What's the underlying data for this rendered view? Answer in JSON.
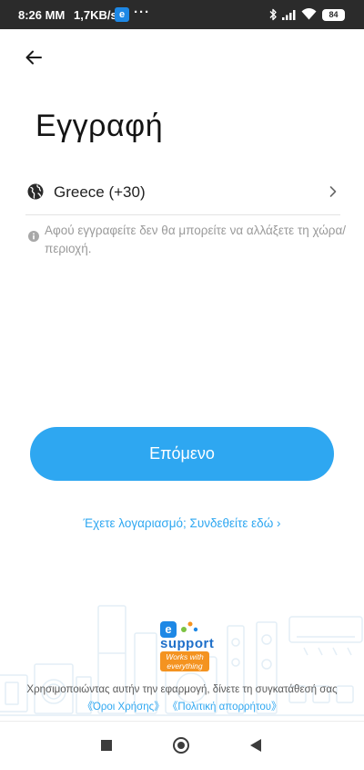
{
  "status_bar": {
    "time": "8:26 MM",
    "speed": "1,7KB/s",
    "app_badge": "e",
    "more": "···",
    "battery": "84"
  },
  "header": {
    "title": "Εγγραφή"
  },
  "country": {
    "label": "Greece (+30)"
  },
  "info": {
    "text": "Αφού εγγραφείτε δεν θα μπορείτε να αλλάξετε τη χώρα/περιοχή."
  },
  "actions": {
    "next_label": "Επόμενο",
    "login_link": "Έχετε λογαριασμό; Συνδεθείτε εδώ ›"
  },
  "logo": {
    "badge_letter": "e",
    "word": "support",
    "tagline": "Works with everything"
  },
  "terms": {
    "text": "Χρησιμοποιώντας αυτήν την εφαρμογή, δίνετε τη συγκατάθεσή σας",
    "terms_link": "《Όροι Χρήσης》",
    "privacy_link": "《Πολιτική απορρήτου》"
  },
  "colors": {
    "accent": "#2ea7f1",
    "status_bar": "#2b2b2b",
    "logo_orange": "#f49320",
    "logo_blue": "#1e6fc9"
  },
  "icons": [
    "back-arrow-icon",
    "globe-icon",
    "chevron-right-icon",
    "info-icon",
    "bluetooth-icon",
    "signal-icon",
    "wifi-icon",
    "battery-icon"
  ]
}
